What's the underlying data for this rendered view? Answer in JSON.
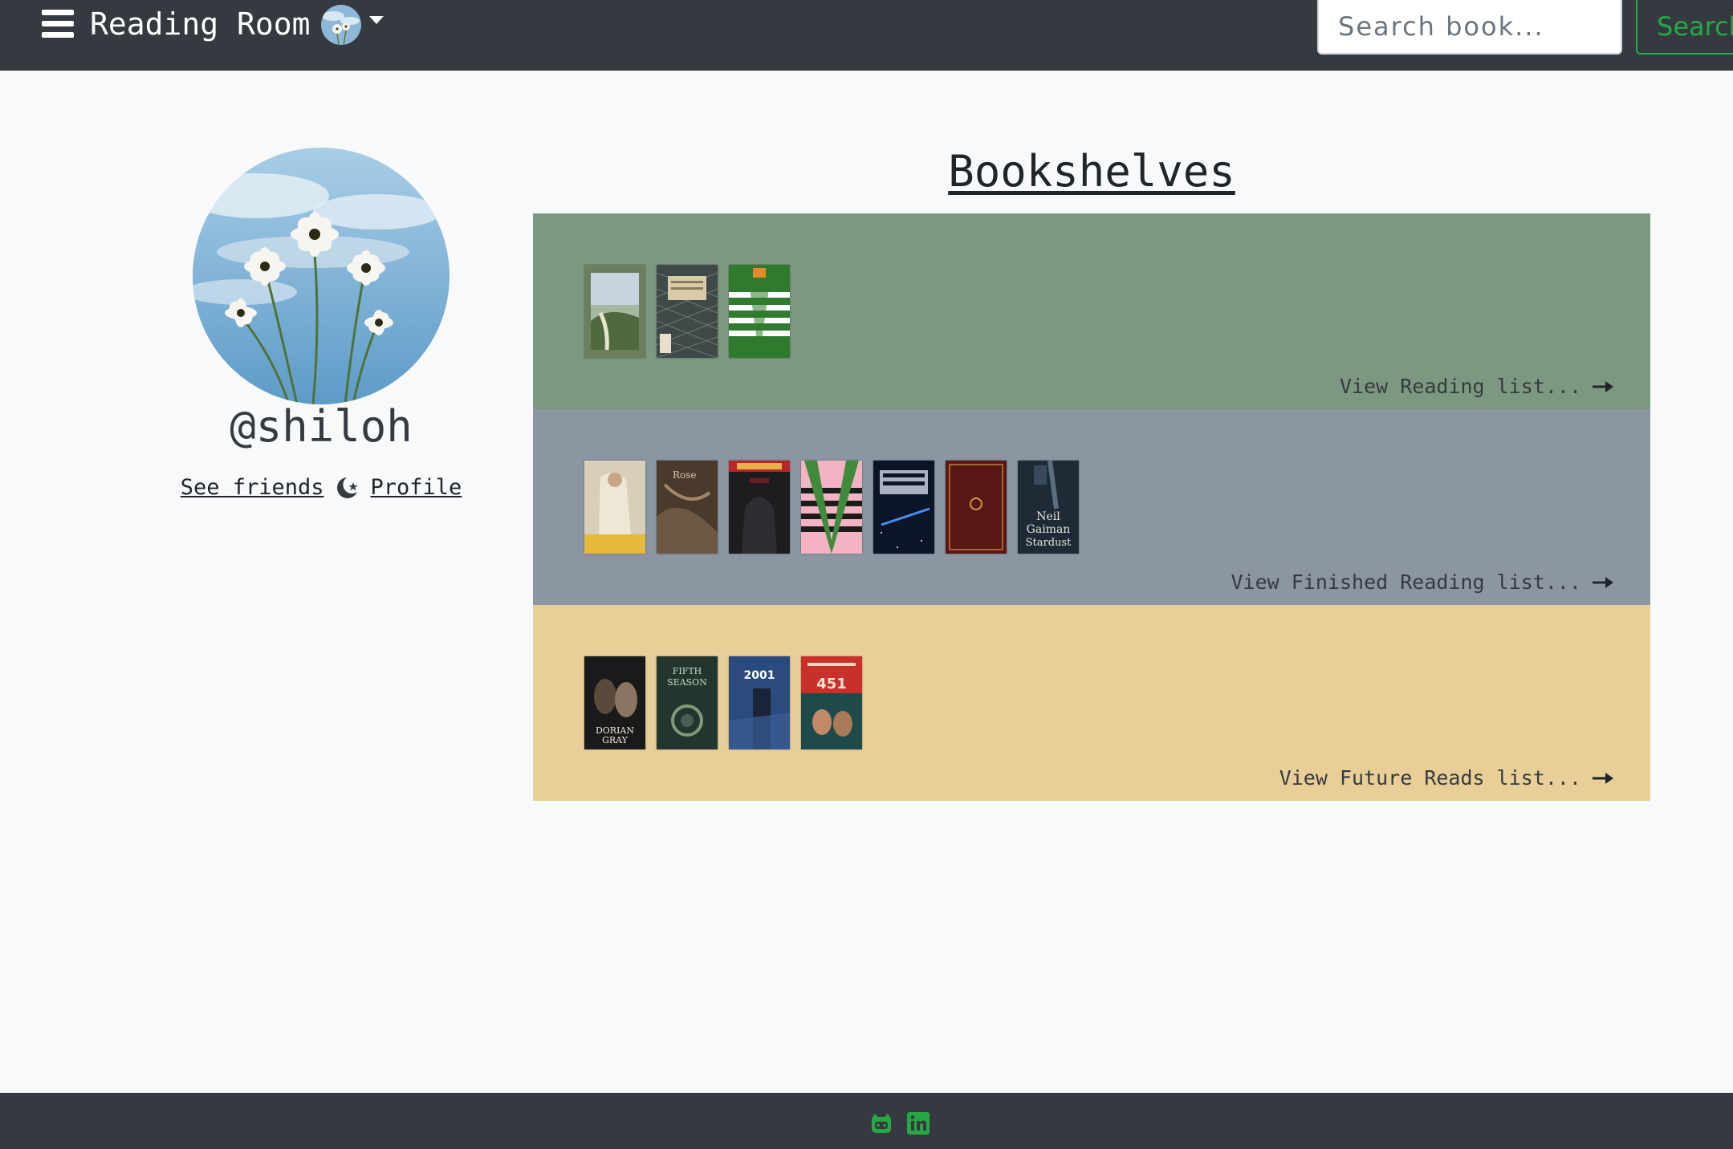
{
  "navbar": {
    "brand": "Reading Room",
    "search_placeholder": "Search book...",
    "search_button": "Search"
  },
  "profile": {
    "username": "@shiloh",
    "see_friends": "See friends",
    "profile_link": "Profile"
  },
  "bookshelves": {
    "title": "Bookshelves",
    "shelves": [
      {
        "name": "Reading",
        "color": "#7d9880",
        "link": "View Reading list...",
        "books": [
          {
            "cover": "landscape-green"
          },
          {
            "cover": "pattern-dark"
          },
          {
            "cover": "breakfast-of-champions-green"
          }
        ]
      },
      {
        "name": "Finished Reading",
        "color": "#8b96a2",
        "link": "View Finished Reading list...",
        "books": [
          {
            "cover": "portrait-yellow"
          },
          {
            "cover": "brown-painting"
          },
          {
            "cover": "harry-potter-dark"
          },
          {
            "cover": "breakfast-of-champions-pink"
          },
          {
            "cover": "space-blue"
          },
          {
            "cover": "maroon-leather"
          },
          {
            "cover": "stardust-dark",
            "text": [
              "Neil",
              "Gaiman",
              "Stardust"
            ]
          }
        ]
      },
      {
        "name": "Future Reads",
        "color": "#e8cf98",
        "link": "View Future Reads list...",
        "books": [
          {
            "cover": "dorian-gray",
            "text": [
              "DORIAN",
              "GRAY"
            ]
          },
          {
            "cover": "fifth-season",
            "text": [
              "FIFTH",
              "SEASON"
            ]
          },
          {
            "cover": "2001-blue",
            "text": [
              "2001"
            ]
          },
          {
            "cover": "fahrenheit-451",
            "text": [
              "451"
            ]
          }
        ]
      }
    ]
  },
  "footer": {
    "icons": [
      "github-icon",
      "linkedin-icon"
    ],
    "icon_color": "#28a745"
  }
}
